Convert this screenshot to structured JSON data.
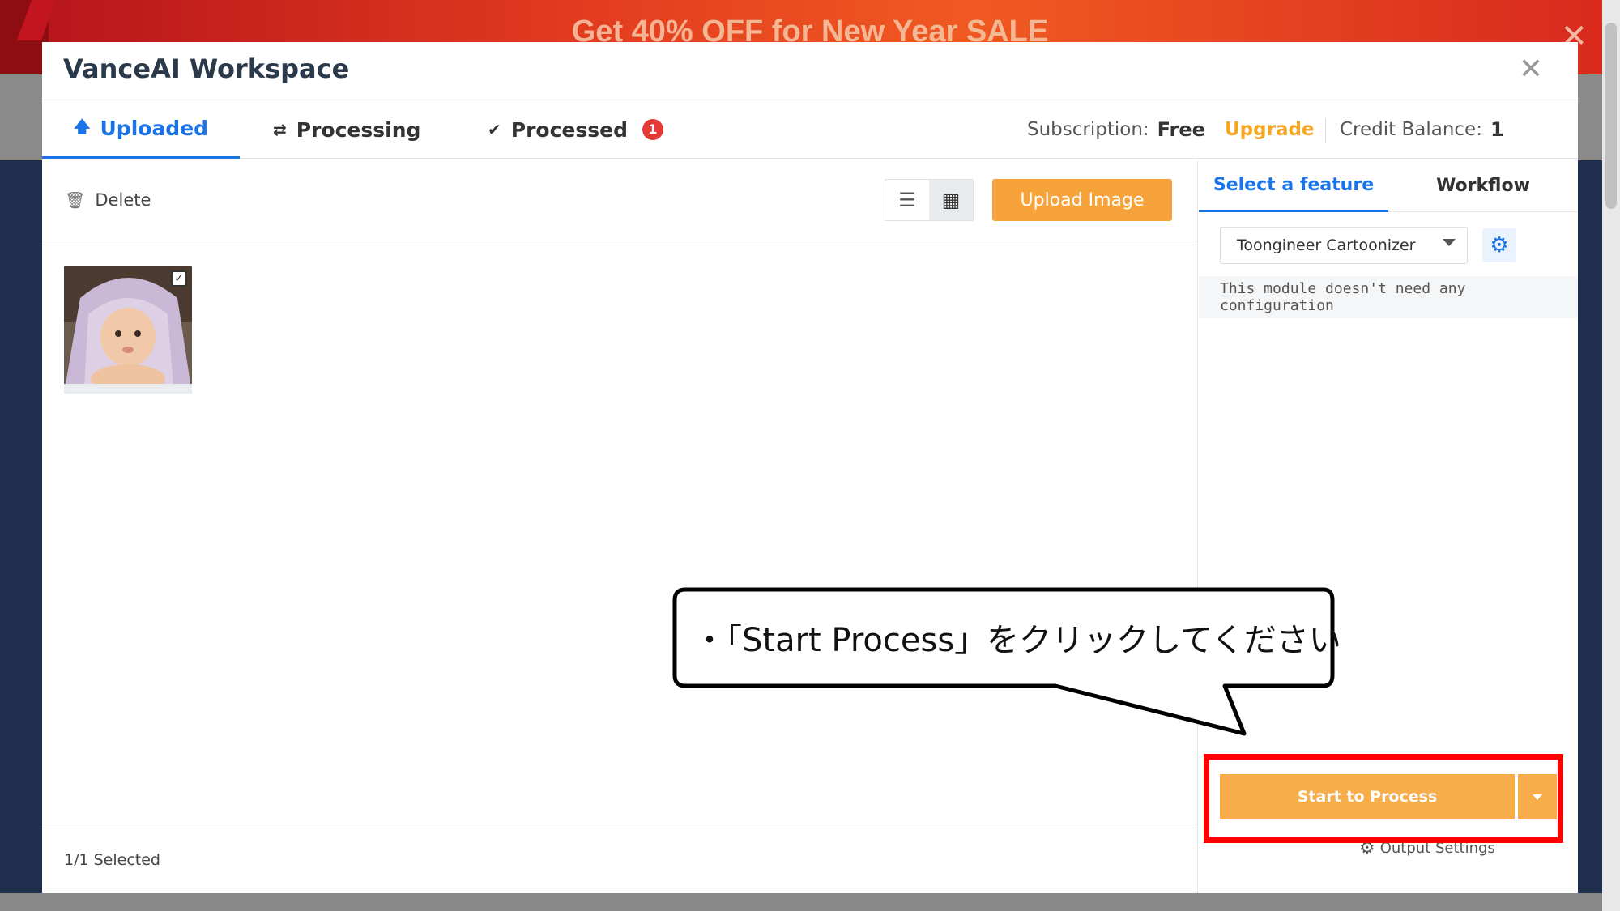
{
  "background": {
    "banner_text": "Get 40% OFF for New Year SALE",
    "banner_close": "✕"
  },
  "modal": {
    "title": "VanceAI Workspace",
    "close": "✕"
  },
  "tabs": [
    {
      "label": "Uploaded",
      "icon": "upload-arrow-icon",
      "active": true
    },
    {
      "label": "Processing",
      "icon": "refresh-icon",
      "active": false
    },
    {
      "label": "Processed",
      "icon": "check-circle-icon",
      "active": false,
      "badge": "1"
    }
  ],
  "account": {
    "subscription_label": "Subscription:",
    "subscription_value": "Free",
    "upgrade": "Upgrade",
    "credit_label": "Credit Balance:",
    "credit_value": "1"
  },
  "toolbar": {
    "delete": "Delete",
    "upload": "Upload Image",
    "view_mode": "grid"
  },
  "footer": {
    "selected": "1/1  Selected"
  },
  "feature_panel": {
    "tabs": [
      "Select a feature",
      "Workflow"
    ],
    "selected_feature": "Toongineer Cartoonizer",
    "config_note": "This module doesn't need any configuration",
    "process_button": "Start to Process",
    "output_settings": "Output Settings"
  },
  "annotation": {
    "callout": "・「Start Process」をクリックしてください",
    "highlight_color": "#ff0000"
  },
  "colors": {
    "accent_blue": "#1a73e8",
    "accent_orange": "#f7a33b",
    "badge_red": "#e53935"
  }
}
